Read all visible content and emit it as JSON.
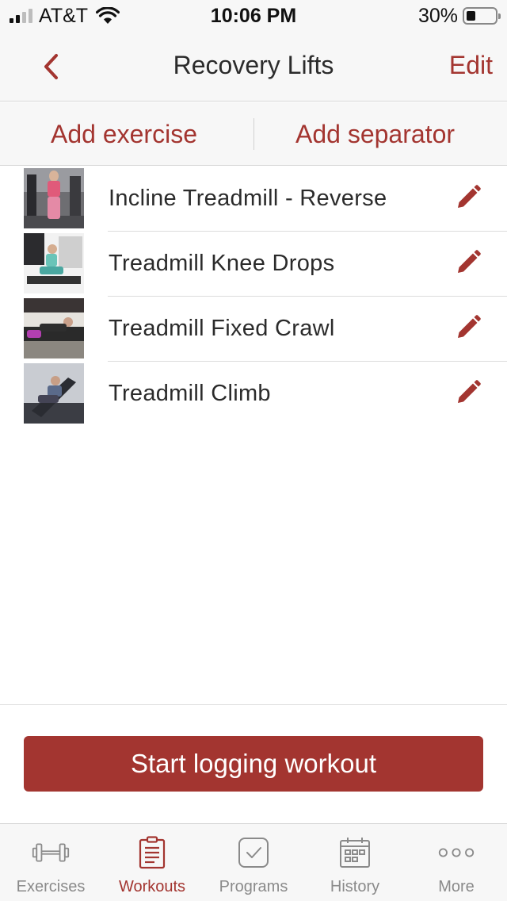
{
  "status_bar": {
    "carrier": "AT&T",
    "time": "10:06 PM",
    "battery_percent": "30%",
    "battery_level": 0.3,
    "signal_bars_active": 2,
    "signal_bars_total": 4
  },
  "nav": {
    "back_icon": "chevron-left-icon",
    "title": "Recovery Lifts",
    "edit_label": "Edit"
  },
  "toolbar": {
    "add_exercise_label": "Add exercise",
    "add_separator_label": "Add separator"
  },
  "exercises": [
    {
      "name": "Incline Treadmill - Reverse",
      "edit_icon": "pencil-icon"
    },
    {
      "name": "Treadmill Knee Drops",
      "edit_icon": "pencil-icon"
    },
    {
      "name": "Treadmill Fixed Crawl",
      "edit_icon": "pencil-icon"
    },
    {
      "name": "Treadmill Climb",
      "edit_icon": "pencil-icon"
    }
  ],
  "start_button_label": "Start logging workout",
  "tabs": [
    {
      "label": "Exercises",
      "icon": "dumbbell-icon",
      "active": false
    },
    {
      "label": "Workouts",
      "icon": "clipboard-icon",
      "active": true
    },
    {
      "label": "Programs",
      "icon": "checkbox-icon",
      "active": false
    },
    {
      "label": "History",
      "icon": "calendar-icon",
      "active": false
    },
    {
      "label": "More",
      "icon": "more-dots-icon",
      "active": false
    }
  ],
  "colors": {
    "accent": "#a33530",
    "inactive": "#8a8a8a",
    "bar_background": "#f7f7f7"
  }
}
